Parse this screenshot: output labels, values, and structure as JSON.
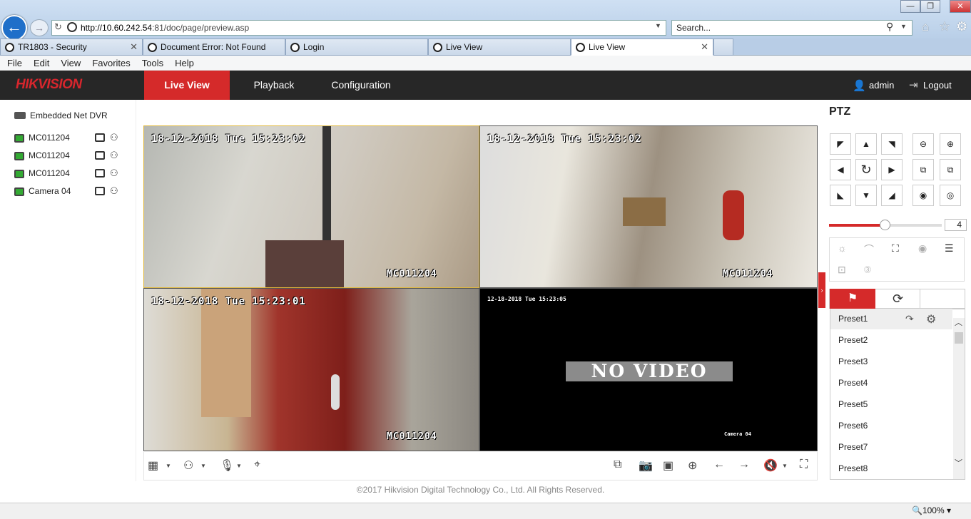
{
  "browser": {
    "url_host": "http://10.60.242.54",
    "url_rest": ":81/doc/page/preview.asp",
    "search_placeholder": "Search...",
    "tabs": [
      {
        "label": "TR1803 - Security",
        "active": false
      },
      {
        "label": "Document Error: Not Found",
        "active": false
      },
      {
        "label": "Login",
        "active": false
      },
      {
        "label": "Live View",
        "active": false
      },
      {
        "label": "Live View",
        "active": true
      }
    ],
    "menu": [
      "File",
      "Edit",
      "View",
      "Favorites",
      "Tools",
      "Help"
    ],
    "zoom": "100%"
  },
  "app": {
    "logo_red": "HIK",
    "logo_rest": "VISION",
    "nav": [
      "Live View",
      "Playback",
      "Configuration"
    ],
    "user": "admin",
    "logout": "Logout",
    "accent": "#d52a2a"
  },
  "tree": {
    "root": "Embedded Net DVR",
    "cameras": [
      "MC011204",
      "MC011204",
      "MC011204",
      "Camera 04"
    ]
  },
  "videos": [
    {
      "osd_time": "18-12-2018 Tue 15:23:02",
      "name": "MC011204"
    },
    {
      "osd_time": "18-12-2018 Tue 15:23:02",
      "name": "MC011204"
    },
    {
      "osd_time": "18-12-2018 Tue 15:23:01",
      "name": "MC011204"
    },
    {
      "osd_time": "12-18-2018 Tue 15:23:05",
      "name": "Camera 04",
      "status": "NO VIDEO"
    }
  ],
  "footer": "©2017 Hikvision Digital Technology Co., Ltd. All Rights Reserved.",
  "ptz": {
    "title": "PTZ",
    "speed": "4",
    "presets": [
      "Preset1",
      "Preset2",
      "Preset3",
      "Preset4",
      "Preset5",
      "Preset6",
      "Preset7",
      "Preset8"
    ]
  }
}
